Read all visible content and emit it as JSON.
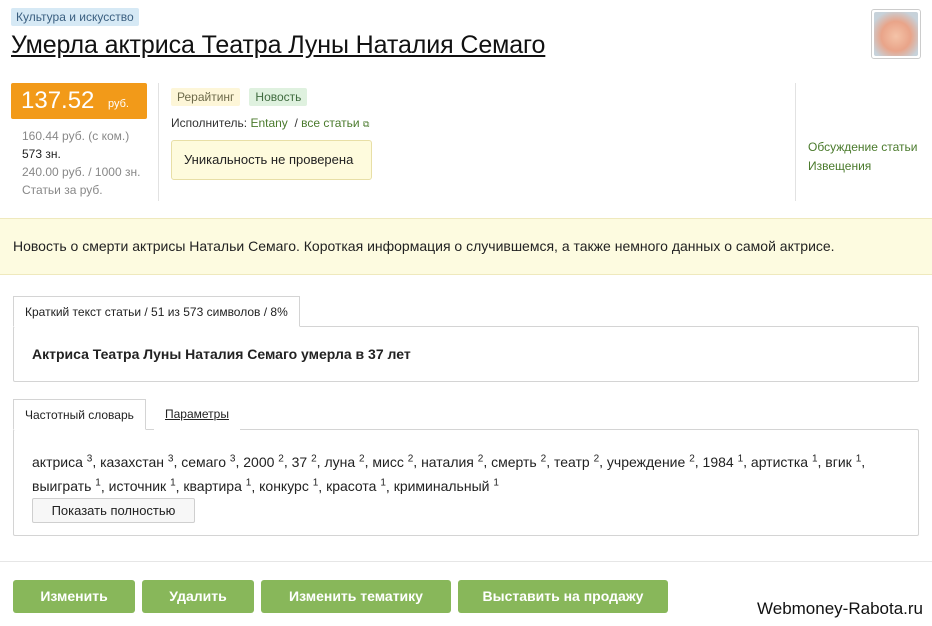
{
  "category": "Культура и искусство",
  "title": "Умерла актриса Театра Луны Наталия Семаго",
  "price": {
    "main": "137.52",
    "unit": "руб.",
    "with_commission": "160.44 руб. (с ком.)",
    "chars": "573 зн.",
    "per_1000": "240.00 руб. / 1000 зн.",
    "articles_link": "Статьи за руб."
  },
  "tags": [
    "Рерайтинг",
    "Новость"
  ],
  "executor": {
    "label": "Исполнитель:",
    "name": "Entany",
    "separator": "/",
    "all_articles": "все статьи"
  },
  "uniqueness": "Уникальность не проверена",
  "right_links": [
    "Обсуждение статьи",
    "Извещения"
  ],
  "description": "Новость о смерти актрисы Натальи Семаго. Короткая информация о случившемся, а также немного данных о самой актрисе.",
  "summary_tab": "Краткий текст статьи / 51 из 573 символов / 8%",
  "summary_text": "Актриса Театра Луны Наталия Семаго умерла в 37 лет",
  "dict_tabs": [
    "Частотный словарь",
    "Параметры"
  ],
  "words": [
    {
      "w": "актриса",
      "n": "3"
    },
    {
      "w": "казахстан",
      "n": "3"
    },
    {
      "w": "семаго",
      "n": "3"
    },
    {
      "w": "2000",
      "n": "2"
    },
    {
      "w": "37",
      "n": "2"
    },
    {
      "w": "луна",
      "n": "2"
    },
    {
      "w": "мисс",
      "n": "2"
    },
    {
      "w": "наталия",
      "n": "2"
    },
    {
      "w": "смерть",
      "n": "2"
    },
    {
      "w": "театр",
      "n": "2"
    },
    {
      "w": "учреждение",
      "n": "2"
    },
    {
      "w": "1984",
      "n": "1"
    },
    {
      "w": "артистка",
      "n": "1"
    },
    {
      "w": "вгик",
      "n": "1"
    },
    {
      "w": "выиграть",
      "n": "1"
    },
    {
      "w": "источник",
      "n": "1"
    },
    {
      "w": "квартира",
      "n": "1"
    },
    {
      "w": "конкурс",
      "n": "1"
    },
    {
      "w": "красота",
      "n": "1"
    },
    {
      "w": "криминальный",
      "n": "1"
    }
  ],
  "show_full": "Показать полностью",
  "buttons": {
    "edit": "Изменить",
    "delete": "Удалить",
    "change_topic": "Изменить тематику",
    "sell": "Выставить на продажу"
  },
  "watermark": "Webmoney-Rabota.ru",
  "icons": {
    "external": "external-link-icon"
  }
}
